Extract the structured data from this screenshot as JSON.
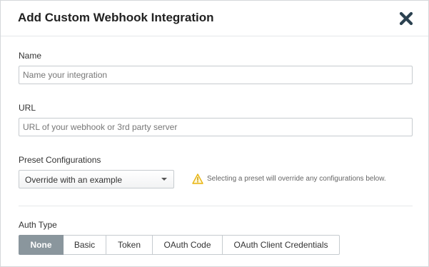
{
  "modal": {
    "title": "Add Custom Webhook Integration",
    "close_icon": "close-x-icon"
  },
  "name_field": {
    "label": "Name",
    "placeholder": "Name your integration",
    "value": ""
  },
  "url_field": {
    "label": "URL",
    "placeholder": "URL of your webhook or 3rd party server",
    "value": ""
  },
  "preset": {
    "label": "Preset Configurations",
    "selected": "Override with an example",
    "warning_icon": "warning-triangle-icon",
    "warning_text": "Selecting a preset will override any configurations below."
  },
  "auth": {
    "label": "Auth Type",
    "options": [
      {
        "label": "None",
        "active": true
      },
      {
        "label": "Basic",
        "active": false
      },
      {
        "label": "Token",
        "active": false
      },
      {
        "label": "OAuth Code",
        "active": false
      },
      {
        "label": "OAuth Client Credentials",
        "active": false
      }
    ]
  },
  "colors": {
    "active_button": "#8a969d",
    "close_icon": "#2b4150",
    "warning_icon": "#e8b40d"
  }
}
